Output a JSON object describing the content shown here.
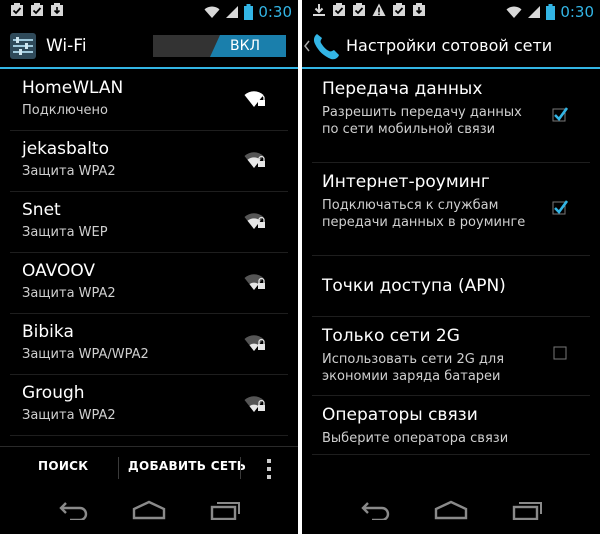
{
  "status_time": "0:30",
  "accent": "#33b5e5",
  "left": {
    "title": "Wi-Fi",
    "toggle_label": "ВКЛ",
    "networks": [
      {
        "name": "HomeWLAN",
        "status": "Подключено"
      },
      {
        "name": "jekasbalto",
        "status": "Защита WPA2"
      },
      {
        "name": "Snet",
        "status": "Защита WEP"
      },
      {
        "name": "OAVOOV",
        "status": "Защита WPA2"
      },
      {
        "name": "Bibika",
        "status": "Защита WPA/WPA2"
      },
      {
        "name": "Grough",
        "status": "Защита WPA2"
      }
    ],
    "search_label": "ПОИСК",
    "add_network_label": "ДОБАВИТЬ СЕТЬ"
  },
  "right": {
    "title": "Настройки сотовой сети",
    "items": [
      {
        "title": "Передача данных",
        "subtitle": "Разрешить передачу данных по сети мобильной связи",
        "checked": true
      },
      {
        "title": "Интернет-роуминг",
        "subtitle": "Подключаться к службам передачи данных в роуминге",
        "checked": true
      },
      {
        "title": "Точки доступа (APN)",
        "subtitle": ""
      },
      {
        "title": "Только сети 2G",
        "subtitle": "Использовать сети 2G для экономии заряда батареи",
        "checked": false
      },
      {
        "title": "Операторы связи",
        "subtitle": "Выберите оператора связи"
      }
    ]
  }
}
